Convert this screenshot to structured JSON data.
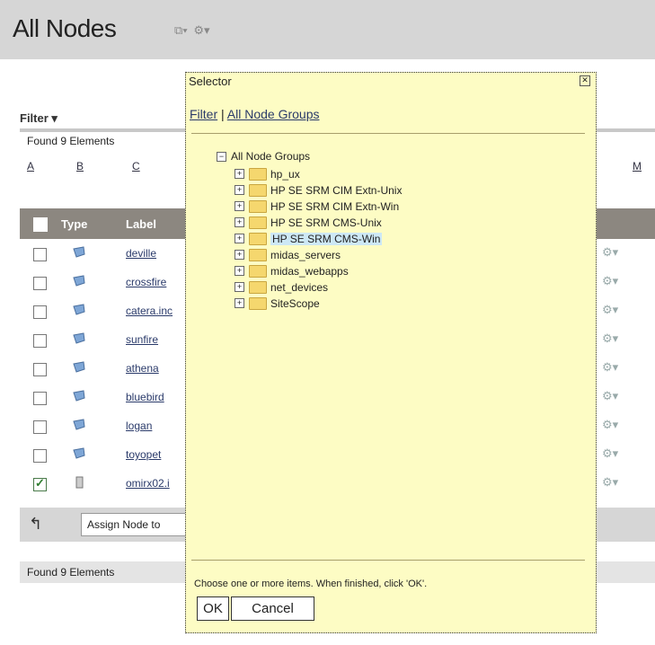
{
  "header": {
    "title": "All Nodes",
    "icons": [
      "view-icon",
      "gear-icon"
    ]
  },
  "filter": {
    "label": "Filter ▾"
  },
  "found": {
    "top": "Found 9 Elements",
    "bottom": "Found 9 Elements"
  },
  "alphabet": [
    "A",
    "B",
    "C",
    "M"
  ],
  "table": {
    "columns": [
      "Type",
      "Label"
    ],
    "rows": [
      {
        "label": "deville",
        "checked": false
      },
      {
        "label": "crossfire",
        "checked": false
      },
      {
        "label": "catera.inc",
        "checked": false
      },
      {
        "label": "sunfire",
        "checked": false
      },
      {
        "label": "athena",
        "checked": false
      },
      {
        "label": "bluebird",
        "checked": false
      },
      {
        "label": "logan",
        "checked": false
      },
      {
        "label": "toyopet",
        "checked": false
      },
      {
        "label": "omirx02.i",
        "checked": true
      }
    ]
  },
  "action": {
    "assign_text": "Assign Node to"
  },
  "selector": {
    "title": "Selector",
    "tab_filter": "Filter",
    "tab_separator": " | ",
    "tab_groups": "All Node Groups",
    "root": "All Node Groups",
    "items": [
      "hp_ux",
      "HP SE SRM CIM Extn-Unix",
      "HP SE SRM CIM Extn-Win",
      "HP SE SRM CMS-Unix",
      "HP SE SRM CMS-Win",
      "midas_servers",
      "midas_webapps",
      "net_devices",
      "SiteScope"
    ],
    "selected_index": 4,
    "help": "Choose one or more items. When finished, click 'OK'.",
    "ok_label": "OK",
    "cancel_label": "Cancel"
  }
}
